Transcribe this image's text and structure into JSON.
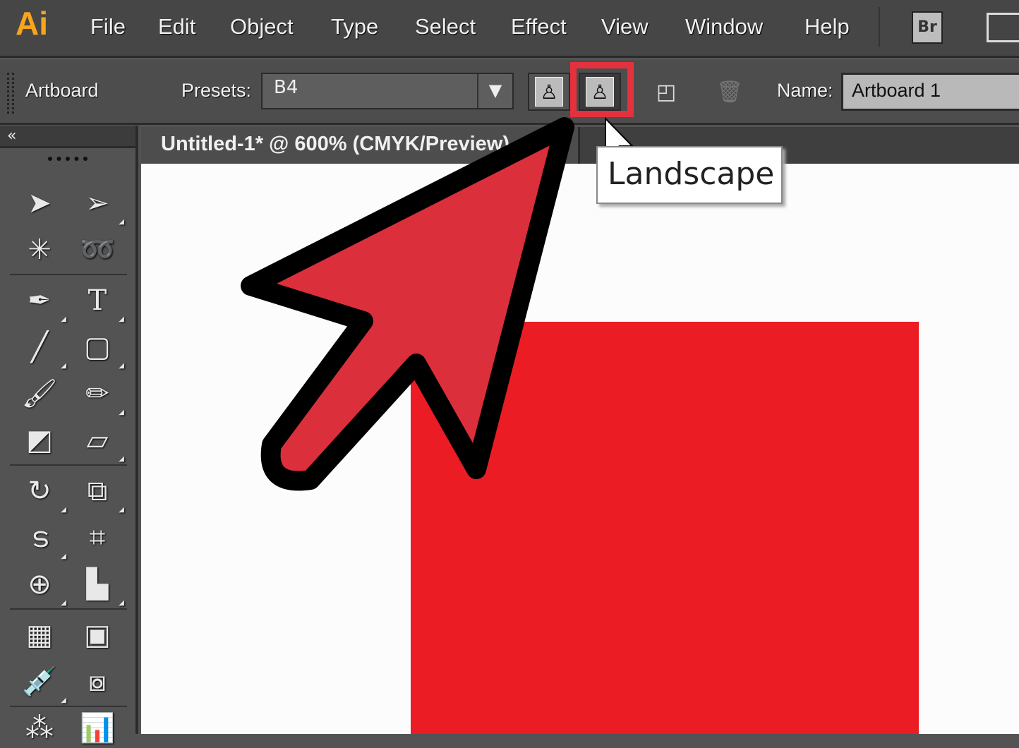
{
  "app": {
    "logo": "Ai",
    "bridge": "Br"
  },
  "menu": [
    "File",
    "Edit",
    "Object",
    "Type",
    "Select",
    "Effect",
    "View",
    "Window",
    "Help"
  ],
  "control": {
    "mode": "Artboard",
    "presets_label": "Presets:",
    "preset_value": "B4",
    "name_label": "Name:",
    "name_value": "Artboard 1"
  },
  "toolpanel": {
    "collapse": "«"
  },
  "document": {
    "tab_title": "Untitled-1* @ 600% (CMYK/Preview)"
  },
  "tooltip": "Landscape",
  "colors": {
    "highlight": "#e3323e",
    "artwork": "#ec1c24",
    "arrow": "#dc2f3c",
    "app_accent": "#f7a51c"
  }
}
